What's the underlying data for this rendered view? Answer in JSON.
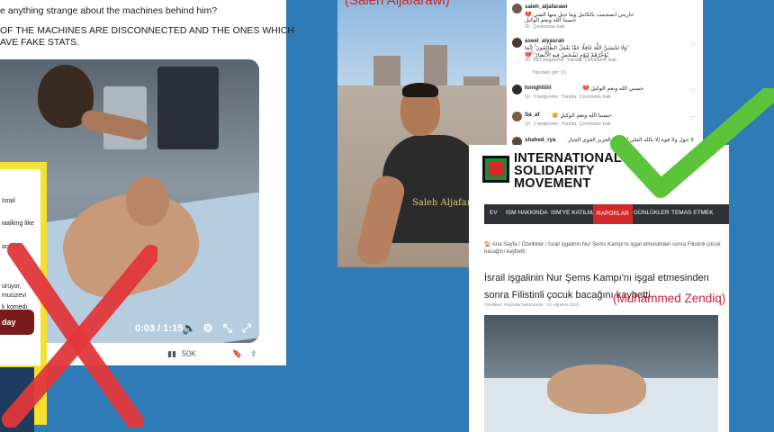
{
  "tweet": {
    "line1": "e anything strange about the machines behind him?",
    "line2": "OF THE MACHINES ARE DISCONNECTED AND THE ONES WHICH",
    "line3": "AVE FAKE STATS.",
    "video_time": "0:03 / 1:15",
    "views": "50K",
    "icons": [
      "play-icon",
      "volume-icon",
      "settings-icon",
      "minimize-icon",
      "fullscreen-icon"
    ]
  },
  "overlay_card": {
    "lines": [
      "İsrail",
      "walking like",
      "actual",
      "mucizevi",
      "ürüyor,",
      "k komedi."
    ],
    "pill": "day"
  },
  "selfie": {
    "caption": "(Saleh Aljafarawi)",
    "watermark": "Saleh Aljafarawi"
  },
  "comments": [
    {
      "user": "saleh_aljafarawi",
      "text": "حاربني انسجمت بالكامل وما جبل منها الشي 💔",
      "text2": "حسبنا الله ونعم الوكيل",
      "time": "2h",
      "action": "Çevirisine bak"
    },
    {
      "user": "aseel_alyasrah",
      "text": "\"وَلَا تَحْسَبَنَّ اللَّهَ غَافِلًا عَمَّا يَعْمَلُ الظَّالِمُونَ ۚ إِنَّمَا",
      "text2": "يُؤَخِّرُهُمْ لِيَوْمٍ تَشْخَصُ فِيهِ الْأَبْصَارُ\" 💔",
      "time": "2h",
      "likes": "643 beğenme",
      "reply": "Yanıtla",
      "action": "Çevirisine bak"
    },
    {
      "user": "tonightiiiii",
      "text": "حسبي الله ونعم الوكيل 💔",
      "time": "1h",
      "likes": "2 beğenme",
      "reply": "Yanıtla",
      "action": "Çevirisine bak"
    },
    {
      "user": "Sa_af",
      "text": "حسبنا الله ونعم الوكيل 😢",
      "time": "1h",
      "likes": "1 beğenme",
      "reply": "Yanıtla",
      "action": "Çevirisine bak"
    },
    {
      "user": "shahed_rya",
      "text": "لا حول ولا قوة إلا بالله العلي العظيم العزيز القوي الجبار",
      "time": "",
      "action": ""
    }
  ],
  "view_replies": "Yanıtları gör (1)",
  "ism": {
    "name_lines": [
      "INTERNATIONAL",
      "SOLIDARITY",
      "MOVEMENT"
    ],
    "nav": [
      "EV",
      "ISM HAKKINDA",
      "ISM'YE KATILMA",
      "RAPORLAR",
      "GÜNLÜKLER",
      "TEMAS ETMEK"
    ],
    "active_nav": "RAPORLAR",
    "breadcrumb": "🏠 Ana Sayfa / Özellikler / İsrail işgalinin Nur Şems Kampı'nı işgal etmesinden sonra Filistinli çocuk bacağını kaybetti",
    "title": "İsrail işgalinin Nur Şems Kampı'nı işgal etmesinden sonra Filistinli çocuk bacağını kaybetti",
    "meta": "Özellikler, Raporlar bölümünde · 01 Ağustos 2023",
    "annotation": "(Muhammed Zendiq)"
  },
  "colors": {
    "background": "#2f7bb8",
    "cross_red": "#e0373a",
    "check_green": "#5cc43a",
    "ism_red": "#d22a2a"
  }
}
